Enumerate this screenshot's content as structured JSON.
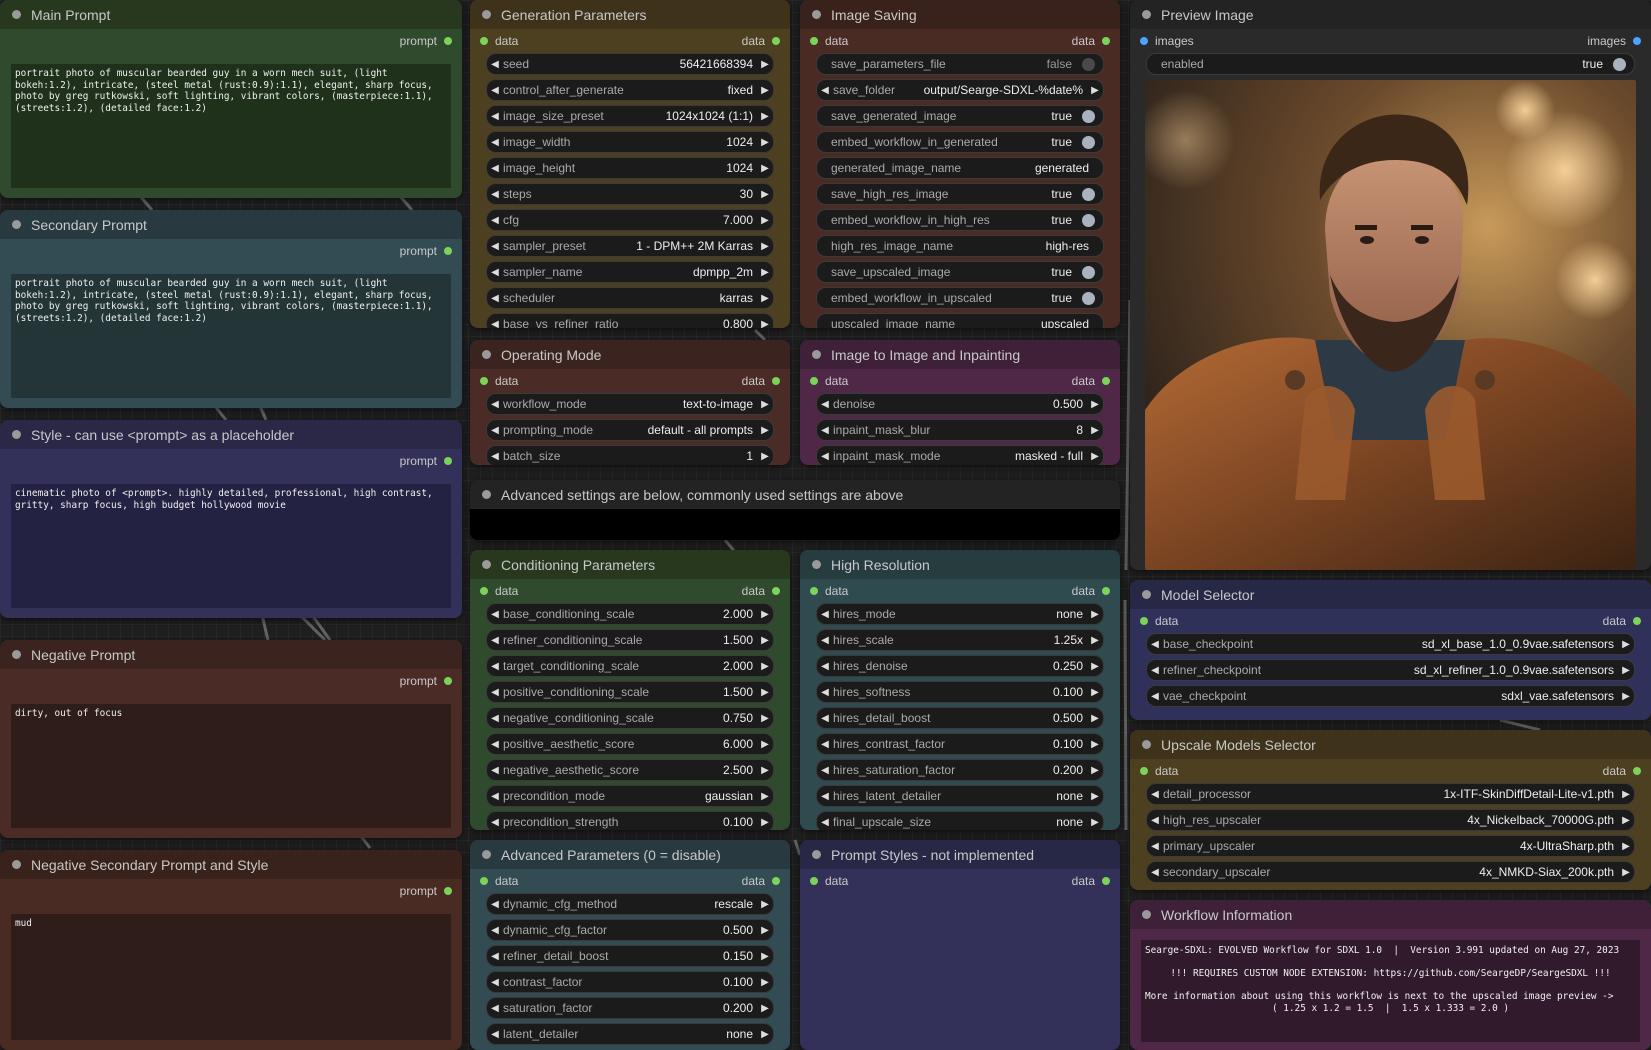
{
  "colors": {
    "green_body": "#2f4a2c",
    "green_title": "#27381f",
    "slate_body": "#334b52",
    "slate_title": "#283a3f",
    "indigo_body": "#33305a",
    "indigo_title": "#2a2747",
    "brown_body": "#4a2b26",
    "brown_title": "#3b2420",
    "olive_body": "#4d4021",
    "olive_title": "#3e331a",
    "rust_body": "#4a2b24",
    "rust_title": "#3a221c",
    "purple_body": "#4e2846",
    "purple_title": "#3e2038",
    "teal_body": "#2f4b4f",
    "teal_title": "#263c3f",
    "blue_body": "#30315a",
    "blue_title": "#262846",
    "port_green": "#7bd35a",
    "port_blue": "#4aa3ff"
  },
  "main_prompt": {
    "title": "Main Prompt",
    "output": "prompt",
    "text": "portrait photo of muscular bearded guy in a worn mech suit, (light bokeh:1.2), intricate, (steel metal (rust:0.9):1.1), elegant, sharp focus, photo by greg rutkowski, soft lighting, vibrant colors, (masterpiece:1.1), (streets:1.2), (detailed face:1.2)"
  },
  "secondary_prompt": {
    "title": "Secondary Prompt",
    "output": "prompt",
    "text": "portrait photo of muscular bearded guy in a worn mech suit, (light bokeh:1.2), intricate, (steel metal (rust:0.9):1.1), elegant, sharp focus, photo by greg rutkowski, soft lighting, vibrant colors, (masterpiece:1.1), (streets:1.2), (detailed face:1.2)"
  },
  "style_prompt": {
    "title": "Style - can use <prompt> as a placeholder",
    "output": "prompt",
    "text": "cinematic photo of <prompt>. highly detailed, professional, high contrast, gritty, sharp focus, high budget hollywood movie"
  },
  "negative_prompt": {
    "title": "Negative Prompt",
    "output": "prompt",
    "text": "dirty, out of focus"
  },
  "negative_secondary": {
    "title": "Negative Secondary Prompt and Style",
    "output": "prompt",
    "text": "mud"
  },
  "generation": {
    "title": "Generation Parameters",
    "in": "data",
    "out": "data",
    "widgets": [
      {
        "name": "seed",
        "value": "56421668394"
      },
      {
        "name": "control_after_generate",
        "value": "fixed"
      },
      {
        "name": "image_size_preset",
        "value": "1024x1024 (1:1)"
      },
      {
        "name": "image_width",
        "value": "1024"
      },
      {
        "name": "image_height",
        "value": "1024"
      },
      {
        "name": "steps",
        "value": "30"
      },
      {
        "name": "cfg",
        "value": "7.000"
      },
      {
        "name": "sampler_preset",
        "value": "1 - DPM++ 2M Karras"
      },
      {
        "name": "sampler_name",
        "value": "dpmpp_2m"
      },
      {
        "name": "scheduler",
        "value": "karras"
      },
      {
        "name": "base_vs_refiner_ratio",
        "value": "0.800"
      }
    ]
  },
  "image_saving": {
    "title": "Image Saving",
    "in": "data",
    "out": "data",
    "widgets": [
      {
        "name": "save_parameters_file",
        "value": "false",
        "type": "toggle",
        "on": false
      },
      {
        "name": "save_folder",
        "value": "output/Searge-SDXL-%date%",
        "type": "combo"
      },
      {
        "name": "save_generated_image",
        "value": "true",
        "type": "toggle",
        "on": true
      },
      {
        "name": "embed_workflow_in_generated",
        "value": "true",
        "type": "toggle",
        "on": true
      },
      {
        "name": "generated_image_name",
        "value": "generated",
        "type": "text"
      },
      {
        "name": "save_high_res_image",
        "value": "true",
        "type": "toggle",
        "on": true
      },
      {
        "name": "embed_workflow_in_high_res",
        "value": "true",
        "type": "toggle",
        "on": true
      },
      {
        "name": "high_res_image_name",
        "value": "high-res",
        "type": "text"
      },
      {
        "name": "save_upscaled_image",
        "value": "true",
        "type": "toggle",
        "on": true
      },
      {
        "name": "embed_workflow_in_upscaled",
        "value": "true",
        "type": "toggle",
        "on": true
      },
      {
        "name": "upscaled_image_name",
        "value": "upscaled",
        "type": "text"
      }
    ]
  },
  "preview": {
    "title": "Preview Image",
    "in": "images",
    "out": "images",
    "enabled_label": "enabled",
    "enabled_value": "true"
  },
  "operating_mode": {
    "title": "Operating Mode",
    "in": "data",
    "out": "data",
    "widgets": [
      {
        "name": "workflow_mode",
        "value": "text-to-image"
      },
      {
        "name": "prompting_mode",
        "value": "default - all prompts"
      },
      {
        "name": "batch_size",
        "value": "1"
      }
    ]
  },
  "img2img": {
    "title": "Image to Image and Inpainting",
    "in": "data",
    "out": "data",
    "widgets": [
      {
        "name": "denoise",
        "value": "0.500"
      },
      {
        "name": "inpaint_mask_blur",
        "value": "8"
      },
      {
        "name": "inpaint_mask_mode",
        "value": "masked - full"
      }
    ]
  },
  "advanced_note": {
    "title": "Advanced settings are below, commonly used settings are above"
  },
  "conditioning": {
    "title": "Conditioning Parameters",
    "in": "data",
    "out": "data",
    "widgets": [
      {
        "name": "base_conditioning_scale",
        "value": "2.000"
      },
      {
        "name": "refiner_conditioning_scale",
        "value": "1.500"
      },
      {
        "name": "target_conditioning_scale",
        "value": "2.000"
      },
      {
        "name": "positive_conditioning_scale",
        "value": "1.500"
      },
      {
        "name": "negative_conditioning_scale",
        "value": "0.750"
      },
      {
        "name": "positive_aesthetic_score",
        "value": "6.000"
      },
      {
        "name": "negative_aesthetic_score",
        "value": "2.500"
      },
      {
        "name": "precondition_mode",
        "value": "gaussian"
      },
      {
        "name": "precondition_strength",
        "value": "0.100"
      }
    ]
  },
  "high_resolution": {
    "title": "High Resolution",
    "in": "data",
    "out": "data",
    "widgets": [
      {
        "name": "hires_mode",
        "value": "none"
      },
      {
        "name": "hires_scale",
        "value": "1.25x"
      },
      {
        "name": "hires_denoise",
        "value": "0.250"
      },
      {
        "name": "hires_softness",
        "value": "0.100"
      },
      {
        "name": "hires_detail_boost",
        "value": "0.500"
      },
      {
        "name": "hires_contrast_factor",
        "value": "0.100"
      },
      {
        "name": "hires_saturation_factor",
        "value": "0.200"
      },
      {
        "name": "hires_latent_detailer",
        "value": "none"
      },
      {
        "name": "final_upscale_size",
        "value": "none"
      }
    ]
  },
  "model_selector": {
    "title": "Model Selector",
    "in": "data",
    "out": "data",
    "widgets": [
      {
        "name": "base_checkpoint",
        "value": "sd_xl_base_1.0_0.9vae.safetensors"
      },
      {
        "name": "refiner_checkpoint",
        "value": "sd_xl_refiner_1.0_0.9vae.safetensors"
      },
      {
        "name": "vae_checkpoint",
        "value": "sdxl_vae.safetensors"
      }
    ]
  },
  "upscale_selector": {
    "title": "Upscale Models Selector",
    "in": "data",
    "out": "data",
    "widgets": [
      {
        "name": "detail_processor",
        "value": "1x-ITF-SkinDiffDetail-Lite-v1.pth"
      },
      {
        "name": "high_res_upscaler",
        "value": "4x_Nickelback_70000G.pth"
      },
      {
        "name": "primary_upscaler",
        "value": "4x-UltraSharp.pth"
      },
      {
        "name": "secondary_upscaler",
        "value": "4x_NMKD-Siax_200k.pth"
      }
    ]
  },
  "advanced_params": {
    "title": "Advanced Parameters (0 = disable)",
    "in": "data",
    "out": "data",
    "widgets": [
      {
        "name": "dynamic_cfg_method",
        "value": "rescale"
      },
      {
        "name": "dynamic_cfg_factor",
        "value": "0.500"
      },
      {
        "name": "refiner_detail_boost",
        "value": "0.150"
      },
      {
        "name": "contrast_factor",
        "value": "0.100"
      },
      {
        "name": "saturation_factor",
        "value": "0.200"
      },
      {
        "name": "latent_detailer",
        "value": "none"
      }
    ]
  },
  "prompt_styles": {
    "title": "Prompt Styles - not implemented",
    "in": "data",
    "out": "data"
  },
  "workflow_info": {
    "title": "Workflow Information",
    "line1": "Searge-SDXL: EVOLVED Workflow for SDXL 1.0  |  Version 3.991 updated on Aug 27, 2023",
    "line2": "!!! REQUIRES CUSTOM NODE EXTENSION: https://github.com/SeargeDP/SeargeSDXL !!!",
    "line3": "More information about using this workflow is next to the upscaled image preview ->",
    "line4": "( 1.25 x 1.2 = 1.5  |  1.5 x 1.333 = 2.0 )"
  }
}
